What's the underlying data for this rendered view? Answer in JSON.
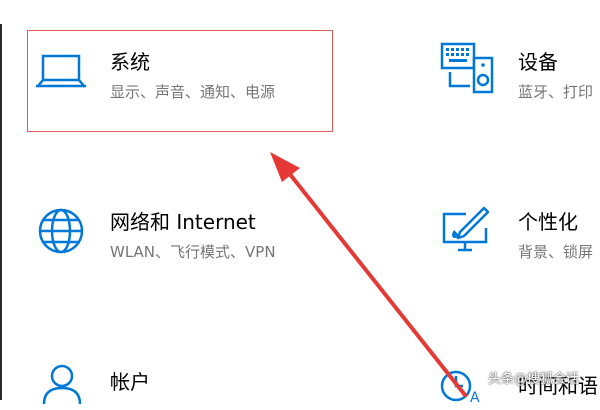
{
  "tiles": {
    "system": {
      "title": "系统",
      "subtitle": "显示、声音、通知、电源",
      "icon": "laptop-icon"
    },
    "devices": {
      "title": "设备",
      "subtitle": "蓝牙、打印",
      "icon": "keyboard-speaker-icon"
    },
    "network": {
      "title": "网络和 Internet",
      "subtitle": "WLAN、飞行模式、VPN",
      "icon": "globe-icon"
    },
    "personalization": {
      "title": "个性化",
      "subtitle": "背景、锁屏",
      "icon": "paint-monitor-icon"
    },
    "accounts": {
      "title": "帐户",
      "icon": "person-icon"
    },
    "time": {
      "title": "时间和语",
      "icon": "clock-language-icon"
    }
  },
  "watermark": "头条@搜狐会话",
  "colors": {
    "accent": "#0078d7",
    "highlight": "#e05a5a",
    "arrow": "#e53935",
    "subtitle": "#767676"
  }
}
